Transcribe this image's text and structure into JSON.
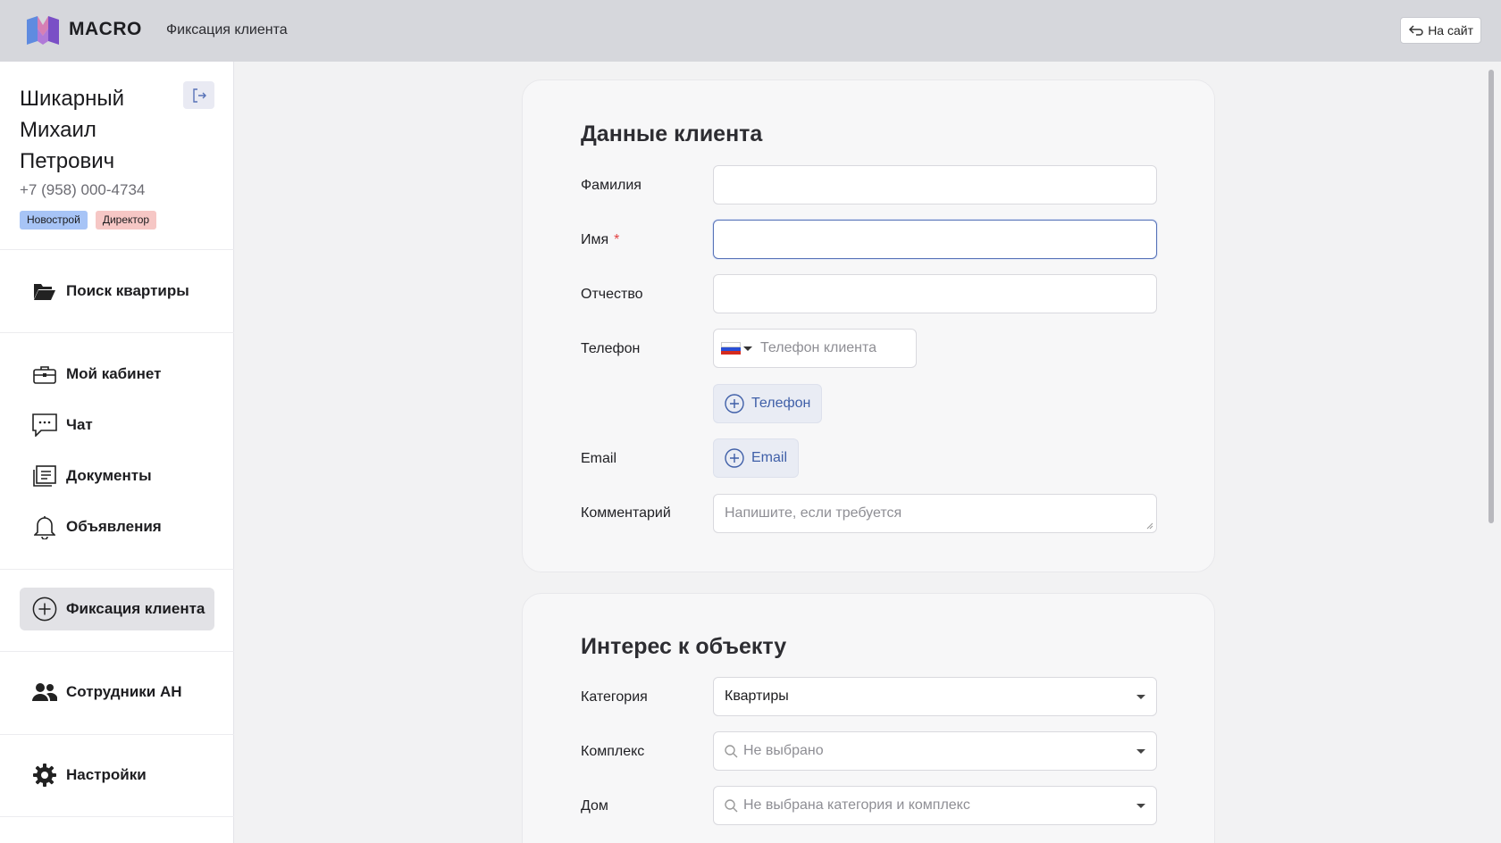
{
  "topbar": {
    "brand": "MACRO",
    "page_title": "Фиксация клиента",
    "to_site_label": "На сайт"
  },
  "user": {
    "name": "Шикарный Михаил Петрович",
    "phone": "+7 (958) 000-4734",
    "badges": [
      "Новострой",
      "Директор"
    ]
  },
  "nav": {
    "search_apartment": "Поиск квартиры",
    "my_cabinet": "Мой кабинет",
    "chat": "Чат",
    "documents": "Документы",
    "announcements": "Объявления",
    "client_fixation": "Фиксация клиента",
    "agency_staff": "Сотрудники АН",
    "settings": "Настройки"
  },
  "client_form": {
    "title": "Данные клиента",
    "last_name_label": "Фамилия",
    "first_name_label": "Имя",
    "required_mark": "*",
    "middle_name_label": "Отчество",
    "phone_label": "Телефон",
    "phone_placeholder": "Телефон клиента",
    "add_phone_label": "Телефон",
    "email_label": "Email",
    "add_email_label": "Email",
    "comment_label": "Комментарий",
    "comment_placeholder": "Напишите, если требуется"
  },
  "interest_form": {
    "title": "Интерес к объекту",
    "category_label": "Категория",
    "category_value": "Квартиры",
    "complex_label": "Комплекс",
    "complex_placeholder": "Не выбрано",
    "house_label": "Дом",
    "house_placeholder": "Не выбрана категория и комплекс"
  },
  "colors": {
    "accent": "#3f5fa8",
    "badge_blue": "#a7c4f6",
    "badge_red": "#f6c7c5",
    "required": "#e34242"
  },
  "icons": {
    "logo": "macro-logo-icon",
    "back": "return-arrow-icon",
    "logout": "logout-icon",
    "search_apartment": "folder-open-icon",
    "my_cabinet": "briefcase-icon",
    "chat": "chat-bubble-icon",
    "documents": "documents-icon",
    "announcements": "bell-icon",
    "client_fixation": "plus-circle-icon",
    "agency_staff": "people-icon",
    "settings": "gear-icon"
  }
}
